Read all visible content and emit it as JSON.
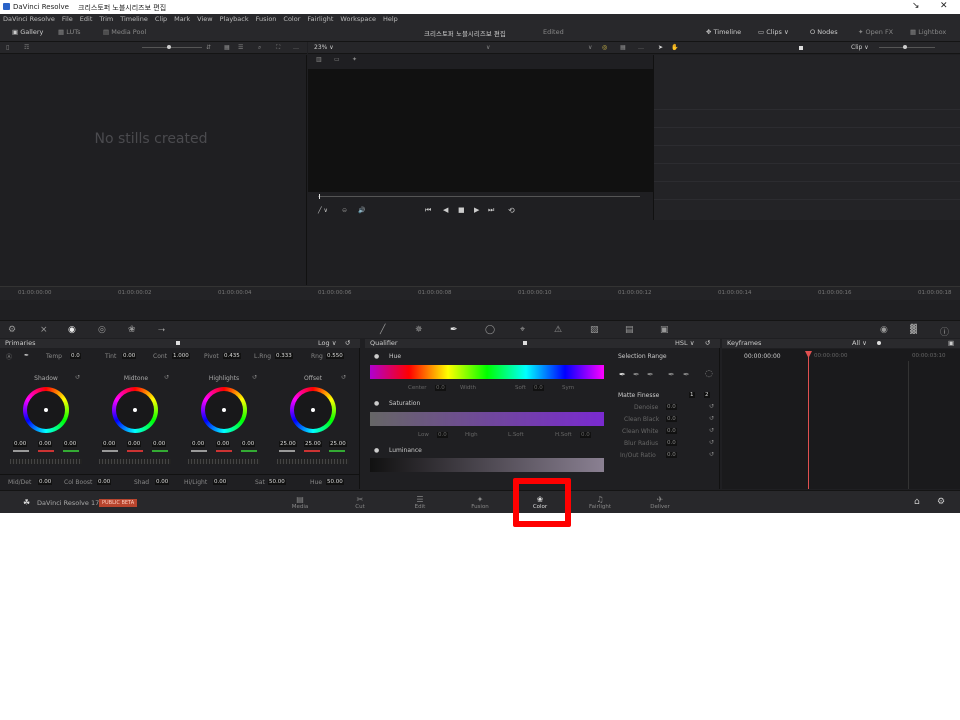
{
  "titlebar": {
    "app_name": "DaVinci Resolve",
    "project": "크리스토퍼 노블시리즈보 편집"
  },
  "menu": [
    "DaVinci Resolve",
    "File",
    "Edit",
    "Trim",
    "Timeline",
    "Clip",
    "Mark",
    "View",
    "Playback",
    "Fusion",
    "Color",
    "Fairlight",
    "Workspace",
    "Help"
  ],
  "toolbar": {
    "gallery": "Gallery",
    "luts": "LUTs",
    "media_pool": "Media Pool",
    "project_title": "크리스토퍼 노블시리즈보 편집",
    "edited": "Edited",
    "timeline": "Timeline",
    "clips": "Clips",
    "nodes": "Nodes",
    "open_fx": "Open FX",
    "lightbox": "Lightbox"
  },
  "viewer": {
    "zoom": "23%",
    "clip_mode": "Clip"
  },
  "gallery": {
    "empty_text": "No stills created"
  },
  "ruler_ticks": [
    "01:00:00:00",
    "01:00:00:02",
    "01:00:00:04",
    "01:00:00:06",
    "01:00:00:08",
    "01:00:00:10",
    "01:00:00:12",
    "01:00:00:14",
    "01:00:00:16",
    "01:00:00:18"
  ],
  "primaries": {
    "title": "Primaries",
    "mode": "Log",
    "temp_label": "Temp",
    "temp": "0.0",
    "tint_label": "Tint",
    "tint": "0.00",
    "cont_label": "Cont",
    "cont": "1.000",
    "pivot_label": "Pivot",
    "pivot": "0.435",
    "lrng_label": "L.Rng",
    "lrng": "0.333",
    "hrng_label": "Rng",
    "hrng": "0.550",
    "wheels": [
      {
        "name": "Shadow",
        "values": [
          "0.00",
          "0.00",
          "0.00"
        ]
      },
      {
        "name": "Midtone",
        "values": [
          "0.00",
          "0.00",
          "0.00"
        ]
      },
      {
        "name": "Highlights",
        "values": [
          "0.00",
          "0.00",
          "0.00"
        ]
      },
      {
        "name": "Offset",
        "values": [
          "25.00",
          "25.00",
          "25.00"
        ]
      }
    ],
    "middetail_label": "Mid/Det",
    "middetail": "0.00",
    "colboost_label": "Col Boost",
    "colboost": "0.00",
    "shad_label": "Shad",
    "shad": "0.00",
    "hilight_label": "Hi/Light",
    "hilight": "0.00",
    "sat_label": "Sat",
    "sat": "50.00",
    "hue_label": "Hue",
    "hue": "50.00"
  },
  "qualifier": {
    "title": "Qualifier",
    "mode": "HSL",
    "hue": "Hue",
    "saturation": "Saturation",
    "luminance": "Luminance",
    "selection_range": "Selection Range",
    "matte_finesse": "Matte Finesse",
    "hue_params": [
      "Center",
      "Width",
      "Soft",
      "Sym"
    ],
    "sat_params": [
      "Low",
      "High",
      "L.Soft",
      "H.Soft"
    ],
    "finesse": [
      {
        "label": "Denoise",
        "value": "0.0"
      },
      {
        "label": "Clean Black",
        "value": "0.0"
      },
      {
        "label": "Clean White",
        "value": "0.0"
      },
      {
        "label": "Blur Radius",
        "value": "0.0"
      },
      {
        "label": "In/Out Ratio",
        "value": "0.0"
      }
    ],
    "param_values": [
      "0.0",
      "0.0",
      "0.0",
      "0.0"
    ]
  },
  "keyframes": {
    "title": "Keyframes",
    "filter": "All",
    "timecode": "00:00:00:00",
    "t1": "00:00:00:00",
    "t2": "00:00:03:10"
  },
  "footer": {
    "app": "DaVinci Resolve 17",
    "badge": "PUBLIC BETA",
    "pages": [
      "Media",
      "Cut",
      "Edit",
      "Fusion",
      "Color",
      "Fairlight",
      "Deliver"
    ],
    "active_page": "Color"
  }
}
